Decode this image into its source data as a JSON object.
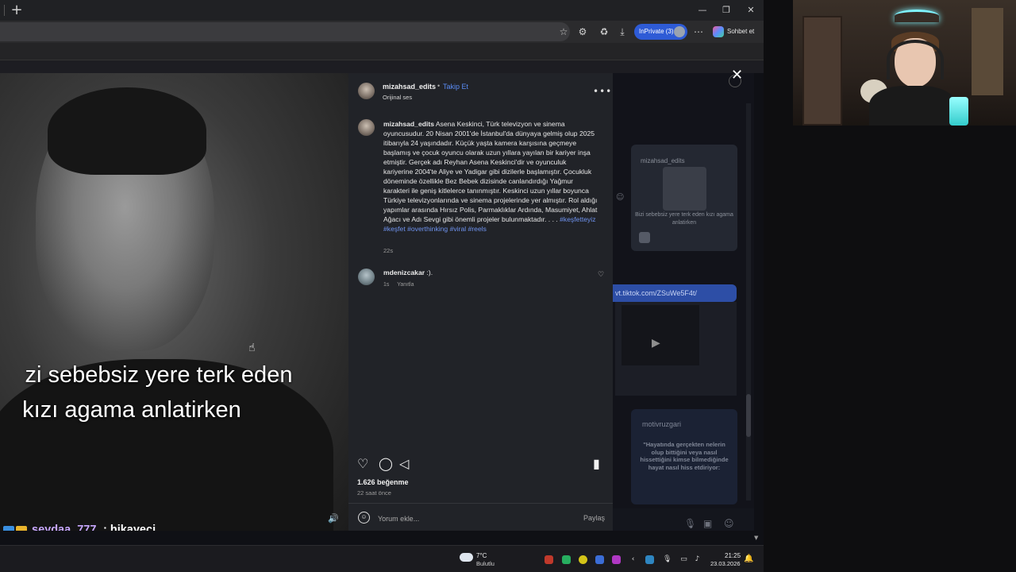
{
  "browser": {
    "inprivate_label": "InPrivate (3)",
    "copilot_label": "Sohbet et"
  },
  "post": {
    "author": "mizahsad_edits",
    "follow_label": "Takip Et",
    "audio_label": "Orijinal ses",
    "caption_user": "mizahsad_edits",
    "caption_text": "Asena Keskinci, Türk televizyon ve sinema oyuncusudur. 20 Nisan 2001'de İstanbul'da dünyaya gelmiş olup 2025 itibarıyla 24 yaşındadır. Küçük yaşta kamera karşısına geçmeye başlamış ve çocuk oyuncu olarak uzun yıllara yayılan bir kariyer inşa etmiştir. Gerçek adı Reyhan Asena Keskinci'dir ve oyunculuk kariyerine 2004'te Aliye ve Yadigar gibi dizilerle başlamıştır. Çocukluk döneminde özellikle Bez Bebek dizisinde canlandırdığı Yağmur karakteri ile geniş kitlelerce tanınmıştır. Keskinci uzun yıllar boyunca Türkiye televizyonlarında ve sinema projelerinde yer almıştır. Rol aldığı yapımlar arasında Hırsız Polis, Parmaklıklar Ardında, Masumiyet, Ahlat Ağacı ve Adı Sevgi gibi önemli projeler bulunmaktadır. . . .",
    "caption_tags": "#keşfetteyiz #keşfet #overthinking #viral #reels",
    "caption_time": "22s",
    "comment_user": "mdenizcakar",
    "comment_text": ":).",
    "comment_time": "1s",
    "comment_reply": "Yanıtla",
    "likes": "1.626 beğenme",
    "posted": "22 saat önce",
    "comment_placeholder": "Yorum ekle...",
    "share_label": "Paylaş"
  },
  "video": {
    "subtitle_line1": "zi sebebsiz yere terk eden",
    "subtitle_line2": "kızı agama anlatirken"
  },
  "background_feed": {
    "card_user": "mizahsad_edits",
    "card_caption": "Bizi sebebsiz yere terk eden kızı agama anlatirken",
    "link_text": "vt.tiktok.com/ZSuWe5F4t/",
    "card2_user": "motivruzgari",
    "card2_quote": "\"Hayatında gerçekten nelerin olup bittiğini veya nasıl hissettiğini kimse bilmediğinde hayat nasıl hiss etdiriyor:"
  },
  "chat": {
    "user": "seydaa_777",
    "message": ": hikayeci"
  },
  "taskbar": {
    "temp": "7°C",
    "weather": "Bulutlu",
    "time": "21:25",
    "date": "23.03.2026"
  },
  "colors": {
    "accent_blue": "#5a8cf5",
    "inprivate_blue": "#2e5bd6",
    "chat_user": "#c8a8ff"
  }
}
